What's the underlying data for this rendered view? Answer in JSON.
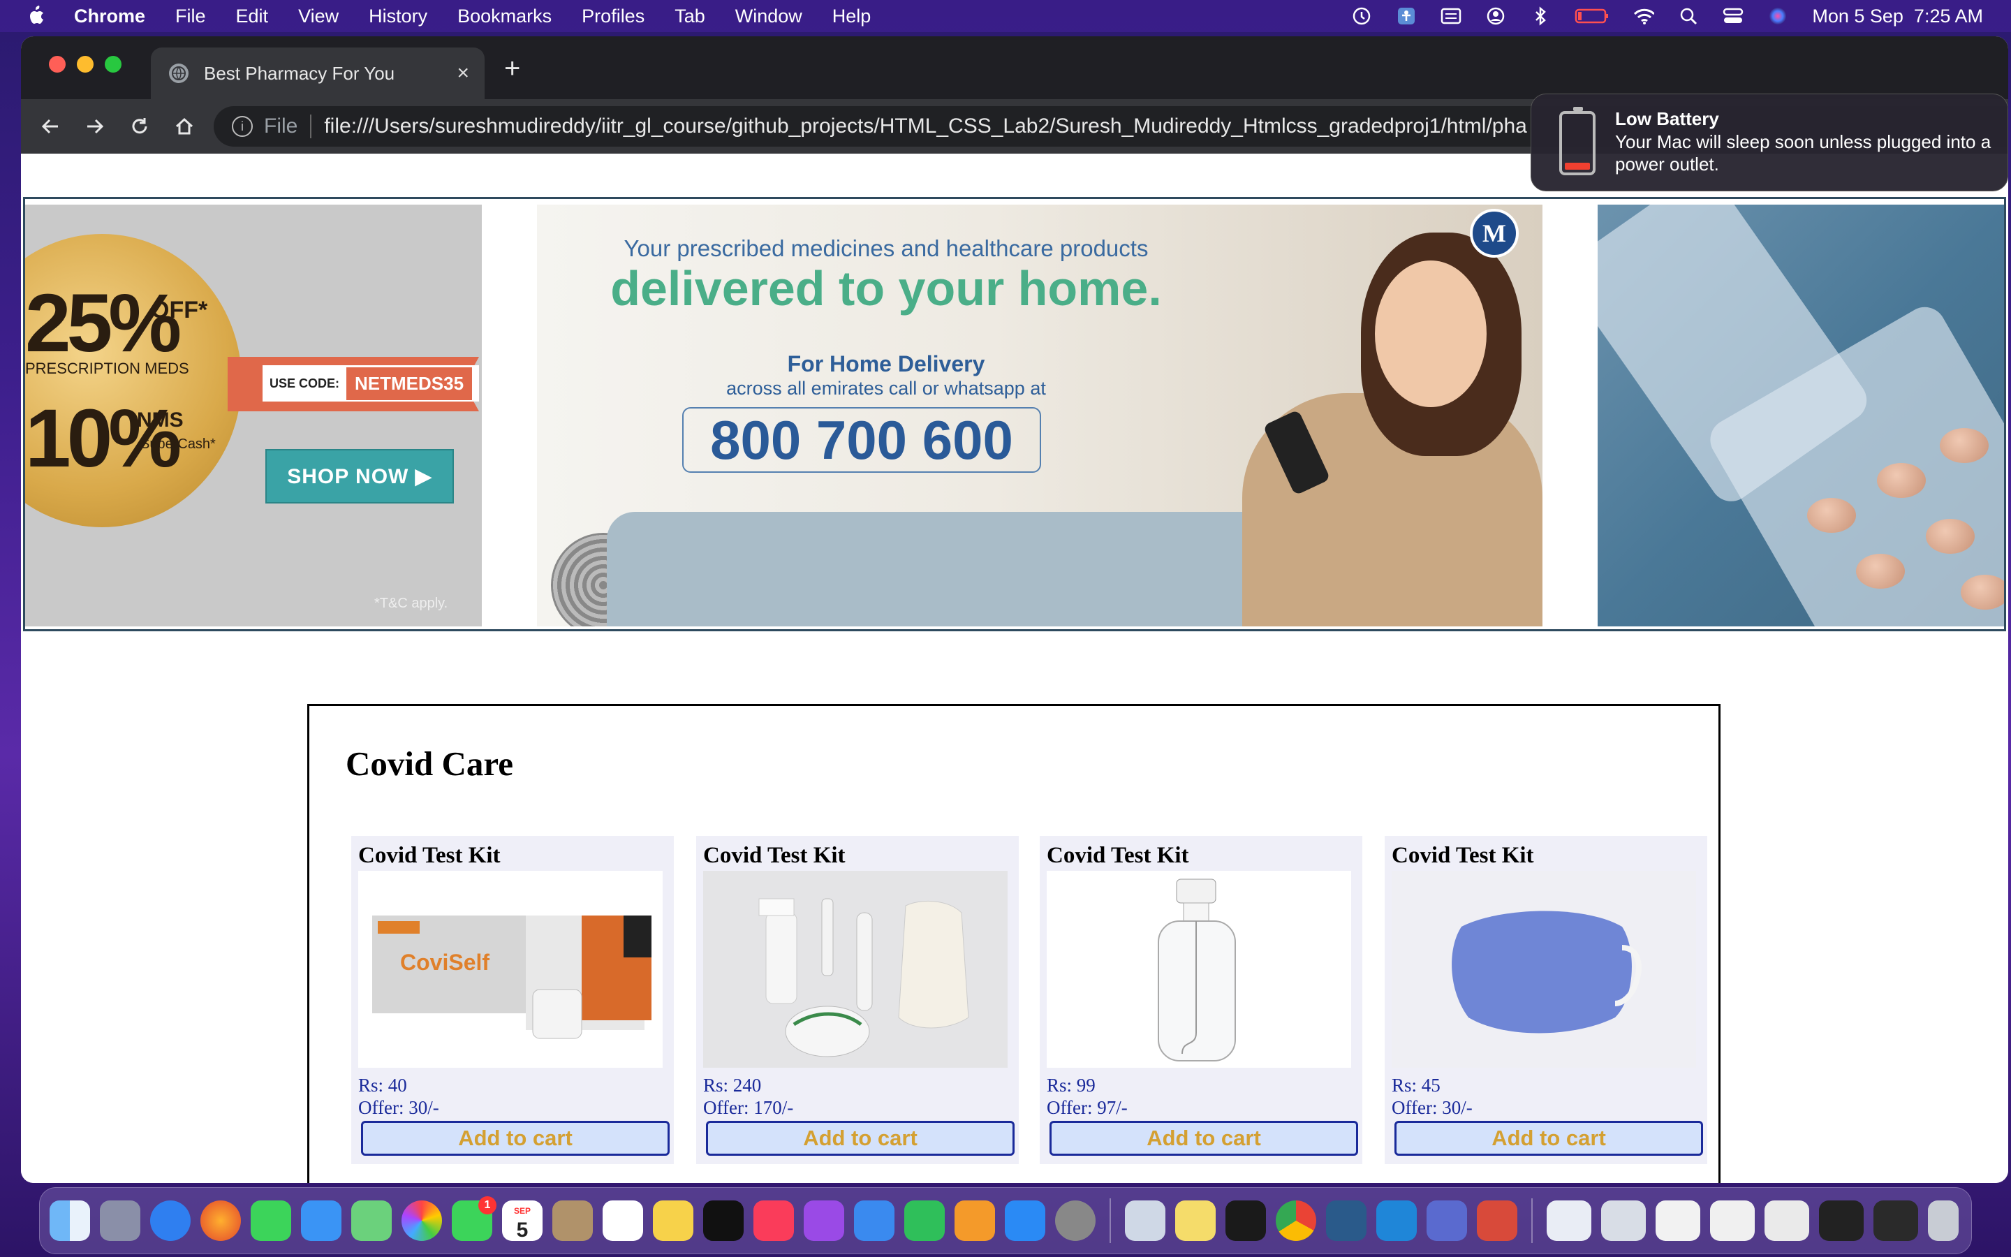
{
  "menubar": {
    "app": "Chrome",
    "items": [
      "File",
      "Edit",
      "View",
      "History",
      "Bookmarks",
      "Profiles",
      "Tab",
      "Window",
      "Help"
    ],
    "clock": "Mon 5 Sep  7:25 AM",
    "status_icons": [
      "time-machine-icon",
      "accessibility-icon",
      "keyboard-icon",
      "user-icon",
      "bluetooth-icon",
      "battery-icon",
      "wifi-icon",
      "search-icon",
      "control-center-icon",
      "siri-icon"
    ]
  },
  "browser": {
    "tab_title": "Best Pharmacy For You",
    "new_tab": "+",
    "close_tab": "×",
    "url_scheme": "File",
    "url": "file:///Users/sureshmudireddy/iitr_gl_course/github_projects/HTML_CSS_Lab2/Suresh_Mudireddy_Htmlcss_gradedproj1/html/pha"
  },
  "notification": {
    "title": "Low Battery",
    "body": "Your Mac will sleep soon unless plugged into a power outlet."
  },
  "banner": {
    "left": {
      "pct1": "25%",
      "off": "OFF*",
      "label1": "PRESCRIPTION MEDS",
      "plus": "+",
      "pct2": "10%",
      "nms": "NMS",
      "supercash": "SuperCash*",
      "use_code": "USE CODE:",
      "code": "NETMEDS35",
      "shop_now": "SHOP NOW ▶",
      "tc": "*T&C apply."
    },
    "middle": {
      "line1": "Your prescribed medicines and healthcare products",
      "line2": "delivered to your home.",
      "line3": "For Home Delivery",
      "line4": "across all emirates call or whatsapp at",
      "phone": "800 700 600"
    }
  },
  "section": {
    "title": "Covid Care",
    "products": [
      {
        "name": "Covid Test Kit",
        "price": "Rs: 40",
        "offer": "Offer: 30/-",
        "button": "Add to cart"
      },
      {
        "name": "Covid Test Kit",
        "price": "Rs: 240",
        "offer": "Offer: 170/-",
        "button": "Add to cart"
      },
      {
        "name": "Covid Test Kit",
        "price": "Rs: 99",
        "offer": "Offer: 97/-",
        "button": "Add to cart"
      },
      {
        "name": "Covid Test Kit",
        "price": "Rs: 45",
        "offer": "Offer: 30/-",
        "button": "Add to cart"
      }
    ]
  },
  "dock": {
    "apps": [
      "finder-icon",
      "launchpad-icon",
      "safari-icon",
      "firefox-icon",
      "messages-icon",
      "mail-icon",
      "maps-icon",
      "photos-icon",
      "facetime-icon",
      "calendar-icon",
      "contacts-icon",
      "reminders-icon",
      "notes-icon",
      "appletv-icon",
      "music-icon",
      "podcasts-icon",
      "keynote-icon",
      "numbers-icon",
      "pages-icon",
      "appstore-icon",
      "system-preferences-icon",
      "preview-icon",
      "stickies-icon",
      "terminal-icon",
      "chrome-icon",
      "mysql-workbench-icon",
      "vscode-icon",
      "bbedit-icon",
      "ccleaner-icon"
    ],
    "calendar_month": "SEP",
    "calendar_day": "5",
    "facetime_badge": "1"
  },
  "colors": {
    "accent_link": "#1a2a9a",
    "button_text": "#d4a032",
    "button_bg": "#d4e2fb",
    "card_bg": "#efeff8"
  }
}
